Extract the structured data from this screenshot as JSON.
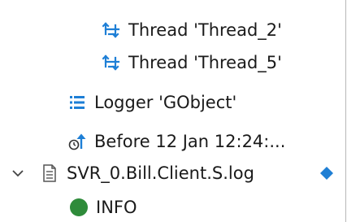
{
  "tree": {
    "rows": [
      {
        "label": "Thread 'Thread_2'",
        "icon": "thread-icon"
      },
      {
        "label": "Thread 'Thread_5'",
        "icon": "thread-icon"
      },
      {
        "label": "Logger 'GObject'",
        "icon": "logger-icon"
      },
      {
        "label": "Before 12 Jan 12:24:...",
        "icon": "time-before-icon"
      },
      {
        "label": "SVR_0.Bill.Client.S.log",
        "icon": "log-file-icon",
        "expanded": true,
        "marker": "diamond-marker-icon"
      },
      {
        "label": "INFO",
        "icon": "info-level-icon"
      }
    ]
  },
  "colors": {
    "thread_icon": "#1e7fd6",
    "logger_icon": "#1e7fd6",
    "time_icon": "#1e7fd6",
    "file_icon": "#555555",
    "diamond": "#1f7fd4",
    "info": "#2e8b3a"
  }
}
